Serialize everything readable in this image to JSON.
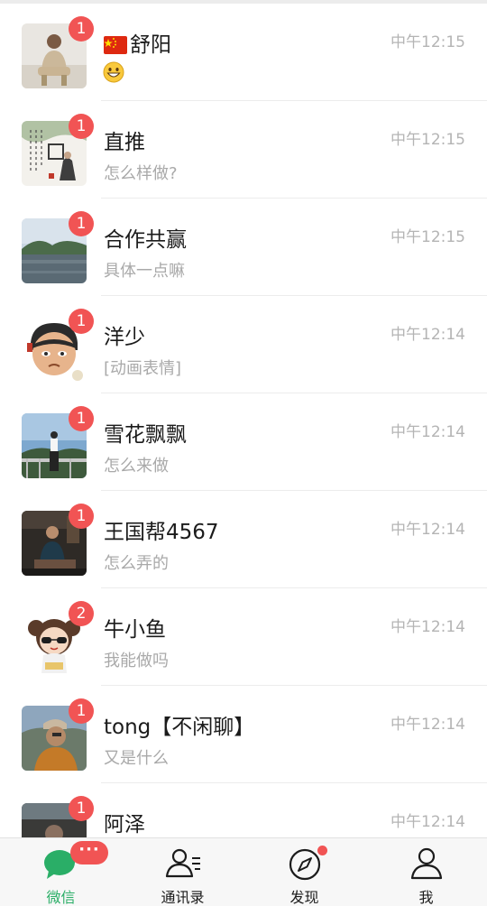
{
  "chats": [
    {
      "name": "舒阳",
      "has_flag": true,
      "flag_icon": "china-flag-icon",
      "time": "中午12:15",
      "preview": "",
      "preview_icon": "grinning-face-emoji",
      "unread": "1",
      "avatar": "man-sitting-photo"
    },
    {
      "name": "直推",
      "time": "中午12:15",
      "preview": "怎么样做?",
      "unread": "1",
      "avatar": "calligraphy-art-avatar"
    },
    {
      "name": "合作共赢",
      "time": "中午12:15",
      "preview": "具体一点嘛",
      "unread": "1",
      "avatar": "lake-landscape-photo"
    },
    {
      "name": "洋少",
      "time": "中午12:14",
      "preview": "[动画表情]",
      "unread": "1",
      "avatar": "cartoon-boy-avatar"
    },
    {
      "name": "雪花飘飘",
      "time": "中午12:14",
      "preview": "怎么来做",
      "unread": "1",
      "avatar": "woman-on-bridge-photo"
    },
    {
      "name": "王国帮4567",
      "time": "中午12:14",
      "preview": "怎么弄的",
      "unread": "1",
      "avatar": "man-at-desk-photo"
    },
    {
      "name": "牛小鱼",
      "time": "中午12:14",
      "preview": "我能做吗",
      "unread": "2",
      "avatar": "cartoon-girl-avatar"
    },
    {
      "name": "tong【不闲聊】",
      "time": "中午12:14",
      "preview": "又是什么",
      "unread": "1",
      "avatar": "man-with-cap-photo"
    },
    {
      "name": "阿泽",
      "time": "中午12:14",
      "preview": "",
      "unread": "1",
      "avatar": "dark-photo-avatar"
    }
  ],
  "tabbar": {
    "tabs": [
      {
        "label": "微信",
        "icon": "chat-bubble-icon",
        "active": true,
        "badge": "···"
      },
      {
        "label": "通讯录",
        "icon": "contacts-icon",
        "active": false
      },
      {
        "label": "发现",
        "icon": "compass-icon",
        "active": false,
        "dot": true
      },
      {
        "label": "我",
        "icon": "person-icon",
        "active": false
      }
    ]
  },
  "colors": {
    "accent_green": "#2aae67",
    "badge_red": "#f15454",
    "time_gray": "#b4b4b4",
    "preview_gray": "#a9a9a9"
  }
}
